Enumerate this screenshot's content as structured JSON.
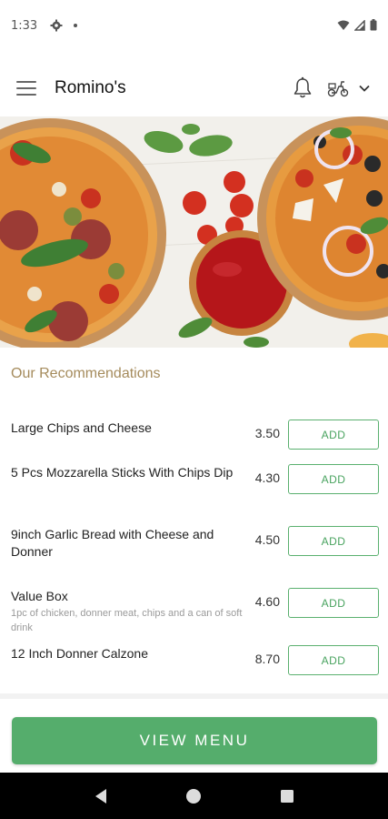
{
  "status_bar": {
    "time": "1:33",
    "icons": [
      "gear-icon",
      "dot-icon",
      "wifi-icon",
      "signal-icon",
      "battery-icon"
    ]
  },
  "header": {
    "title": "Romino's",
    "icons": [
      "menu-icon",
      "bell-icon",
      "scooter-icon",
      "chevron-down-icon"
    ]
  },
  "hero": {
    "description_icon": "pizza-hero-image"
  },
  "recommendations": {
    "title": "Our Recommendations",
    "items": [
      {
        "name": "Large Chips and Cheese",
        "description": "",
        "price": "3.50",
        "button": "ADD"
      },
      {
        "name": "5 Pcs Mozzarella Sticks With Chips Dip",
        "description": "",
        "price": "4.30",
        "button": "ADD"
      },
      {
        "name": "9inch Garlic Bread with Cheese and Donner",
        "description": "",
        "price": "4.50",
        "button": "ADD"
      },
      {
        "name": "Value Box",
        "description": "1pc of chicken, donner meat, chips and a can of soft drink",
        "price": "4.60",
        "button": "ADD"
      },
      {
        "name": "12 Inch Donner Calzone",
        "description": "",
        "price": "8.70",
        "button": "ADD"
      }
    ]
  },
  "footer": {
    "view_menu_label": "VIEW MENU"
  },
  "nav_bar": {
    "icons": [
      "back-icon",
      "home-icon",
      "recents-icon"
    ]
  },
  "colors": {
    "accent_green": "#55ad6c",
    "section_title": "#a58b5c"
  }
}
